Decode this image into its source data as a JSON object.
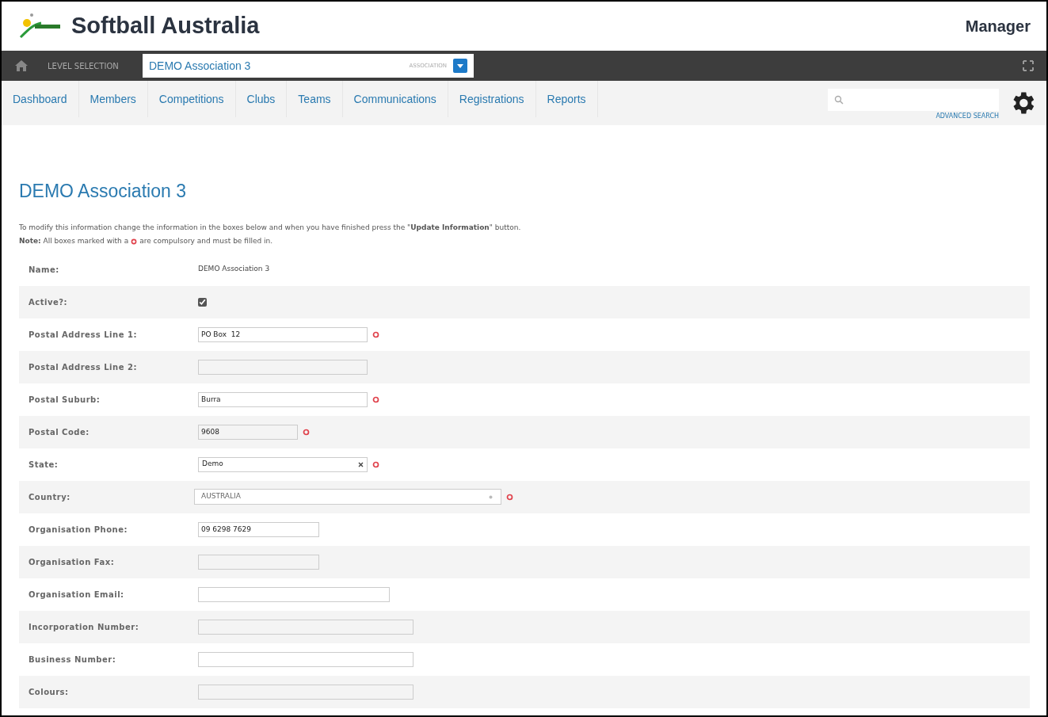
{
  "header": {
    "title": "Softball Australia",
    "user_role": "Manager"
  },
  "level_bar": {
    "label": "LEVEL SELECTION",
    "selection": "DEMO Association 3",
    "level_type": "ASSOCIATION"
  },
  "nav": {
    "items": [
      {
        "label": "Dashboard",
        "selected": false
      },
      {
        "label": "Members",
        "selected": false
      },
      {
        "label": "Competitions",
        "selected": false
      },
      {
        "label": "Clubs",
        "selected": false
      },
      {
        "label": "Teams",
        "selected": false
      },
      {
        "label": "Communications",
        "selected": false
      },
      {
        "label": "Registrations",
        "selected": false
      },
      {
        "label": "Reports",
        "selected": false
      }
    ],
    "advanced_search": "ADVANCED SEARCH"
  },
  "page": {
    "heading": "DEMO Association 3",
    "intro": "To modify this information change the information in the boxes below and when you have finished press the \"**Update Information**\" button.",
    "note_before": "**Note:** All boxes marked with a",
    "note_after": "are compulsory and must be filled in."
  },
  "form": {
    "rows": [
      {
        "label": "Name:",
        "kind": "text",
        "value": "DEMO Association 3",
        "required": false
      },
      {
        "label": "Active?:",
        "kind": "checkbox",
        "checked": true,
        "required": false
      },
      {
        "label": "Postal Address Line 1:",
        "kind": "input",
        "value": "PO Box  12",
        "required": true
      },
      {
        "label": "Postal Address Line 2:",
        "kind": "input",
        "required": false
      },
      {
        "label": "Postal Suburb:",
        "kind": "input",
        "value": "Burra",
        "required": true
      },
      {
        "label": "Postal Code:",
        "kind": "input",
        "value": "9608",
        "required": true
      },
      {
        "label": "State:",
        "kind": "select",
        "value": "Demo",
        "required": true
      },
      {
        "label": "Country:",
        "kind": "combo",
        "value": "AUSTRALIA",
        "required": true
      },
      {
        "label": "Organisation Phone:",
        "kind": "input",
        "value": "09 6298 7629",
        "required": false
      },
      {
        "label": "Organisation Fax:",
        "kind": "input",
        "required": false
      },
      {
        "label": "Organisation Email:",
        "kind": "input",
        "required": false
      },
      {
        "label": "Incorporation Number:",
        "kind": "input",
        "required": false
      },
      {
        "label": "Business Number:",
        "kind": "input",
        "required": false
      },
      {
        "label": "Colours:",
        "kind": "input",
        "required": false
      }
    ]
  }
}
